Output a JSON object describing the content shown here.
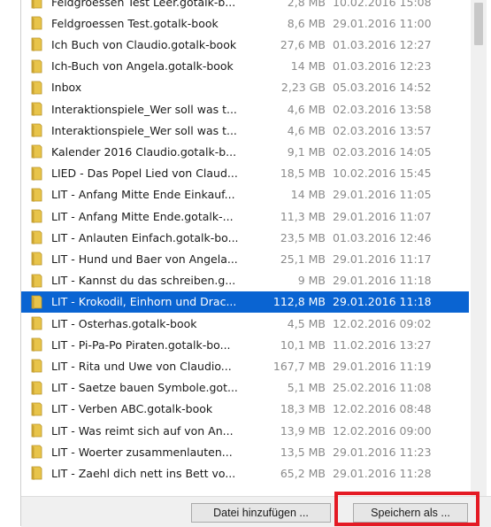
{
  "files": [
    {
      "name": "Feldgroessen Test Leer.gotalk-b...",
      "size": "2,8 MB",
      "date": "10.02.2016 15:08",
      "selected": false
    },
    {
      "name": "Feldgroessen Test.gotalk-book",
      "size": "8,6 MB",
      "date": "29.01.2016 11:00",
      "selected": false
    },
    {
      "name": "Ich Buch von Claudio.gotalk-book",
      "size": "27,6 MB",
      "date": "01.03.2016 12:27",
      "selected": false
    },
    {
      "name": "Ich-Buch von Angela.gotalk-book",
      "size": "14 MB",
      "date": "01.03.2016 12:23",
      "selected": false
    },
    {
      "name": "Inbox",
      "size": "2,23 GB",
      "date": "05.03.2016 14:52",
      "selected": false
    },
    {
      "name": "Interaktionspiele_Wer soll was t...",
      "size": "4,6 MB",
      "date": "02.03.2016 13:58",
      "selected": false
    },
    {
      "name": "Interaktionspiele_Wer soll was t...",
      "size": "4,6 MB",
      "date": "02.03.2016 13:57",
      "selected": false
    },
    {
      "name": "Kalender 2016 Claudio.gotalk-b...",
      "size": "9,1 MB",
      "date": "02.03.2016 14:05",
      "selected": false
    },
    {
      "name": "LIED - Das Popel Lied von Claud...",
      "size": "18,5 MB",
      "date": "10.02.2016 15:45",
      "selected": false
    },
    {
      "name": "LIT - Anfang Mitte Ende Einkauf...",
      "size": "14 MB",
      "date": "29.01.2016 11:05",
      "selected": false
    },
    {
      "name": "LIT - Anfang Mitte Ende.gotalk-...",
      "size": "11,3 MB",
      "date": "29.01.2016 11:07",
      "selected": false
    },
    {
      "name": "LIT - Anlauten Einfach.gotalk-bo...",
      "size": "23,5 MB",
      "date": "01.03.2016 12:46",
      "selected": false
    },
    {
      "name": "LIT - Hund und Baer von Angela...",
      "size": "25,1 MB",
      "date": "29.01.2016 11:17",
      "selected": false
    },
    {
      "name": "LIT - Kannst du das schreiben.g...",
      "size": "9 MB",
      "date": "29.01.2016 11:18",
      "selected": false
    },
    {
      "name": "LIT - Krokodil, Einhorn und Drac...",
      "size": "112,8 MB",
      "date": "29.01.2016 11:18",
      "selected": true
    },
    {
      "name": "LIT - Osterhas.gotalk-book",
      "size": "4,5 MB",
      "date": "12.02.2016 09:02",
      "selected": false
    },
    {
      "name": "LIT - Pi-Pa-Po Piraten.gotalk-bo...",
      "size": "10,1 MB",
      "date": "11.02.2016 13:27",
      "selected": false
    },
    {
      "name": "LIT - Rita und Uwe von Claudio...",
      "size": "167,7 MB",
      "date": "29.01.2016 11:19",
      "selected": false
    },
    {
      "name": "LIT - Saetze bauen Symbole.got...",
      "size": "5,1 MB",
      "date": "25.02.2016 11:08",
      "selected": false
    },
    {
      "name": "LIT - Verben ABC.gotalk-book",
      "size": "18,3 MB",
      "date": "12.02.2016 08:48",
      "selected": false
    },
    {
      "name": "LIT - Was reimt sich auf von An...",
      "size": "13,9 MB",
      "date": "12.02.2016 09:00",
      "selected": false
    },
    {
      "name": "LIT - Woerter zusammenlauten...",
      "size": "13,5 MB",
      "date": "29.01.2016 11:23",
      "selected": false
    },
    {
      "name": "LIT - Zaehl dich nett ins Bett vo...",
      "size": "65,2 MB",
      "date": "29.01.2016 11:28",
      "selected": false
    }
  ],
  "buttons": {
    "add_label": "Datei hinzufügen ...",
    "save_label": "Speichern als ..."
  },
  "colors": {
    "selection": "#0a64d2",
    "highlight_box": "#e41a24",
    "folder": "#e8c44a"
  }
}
